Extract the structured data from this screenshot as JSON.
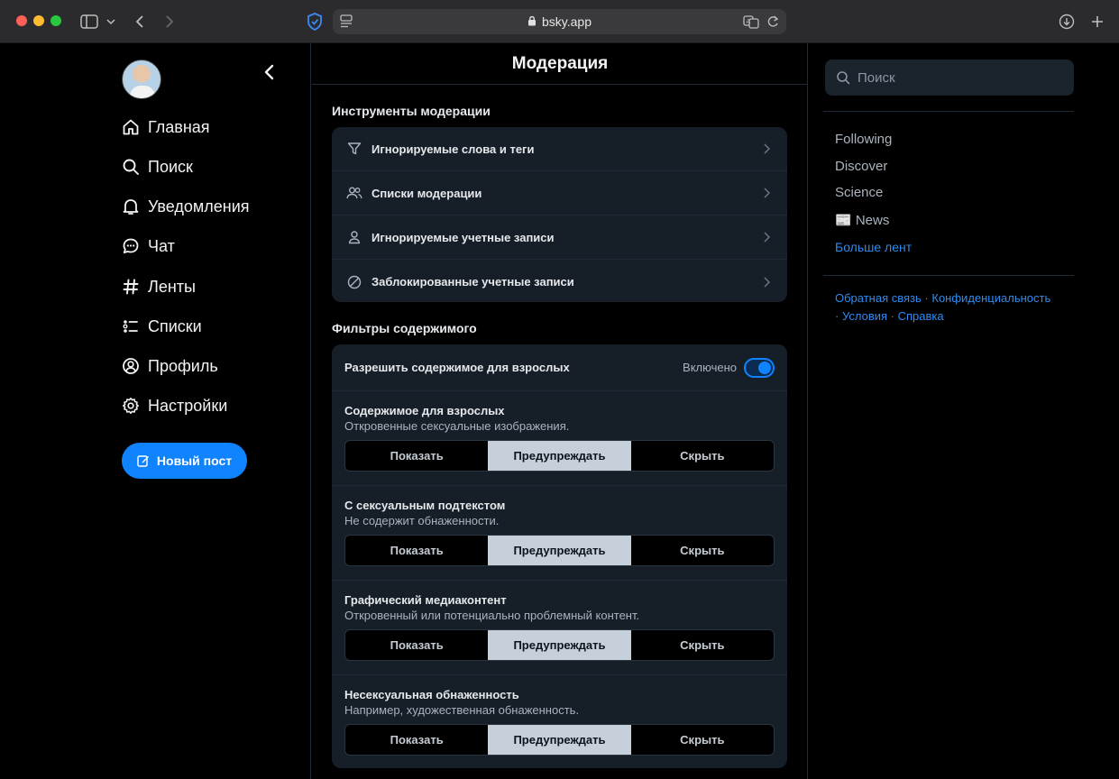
{
  "browser": {
    "url": "bsky.app"
  },
  "nav": {
    "items": [
      {
        "label": "Главная"
      },
      {
        "label": "Поиск"
      },
      {
        "label": "Уведомления"
      },
      {
        "label": "Чат"
      },
      {
        "label": "Ленты"
      },
      {
        "label": "Списки"
      },
      {
        "label": "Профиль"
      },
      {
        "label": "Настройки"
      }
    ],
    "new_post": "Новый пост"
  },
  "main": {
    "title": "Модерация",
    "tools_title": "Инструменты модерации",
    "tools": [
      {
        "label": "Игнорируемые слова и теги",
        "icon": "filter-icon"
      },
      {
        "label": "Списки модерации",
        "icon": "users-icon"
      },
      {
        "label": "Игнорируемые учетные записи",
        "icon": "person-icon"
      },
      {
        "label": "Заблокированные учетные записи",
        "icon": "block-icon"
      }
    ],
    "filters_title": "Фильтры содержимого",
    "adult": {
      "label": "Разрешить содержимое для взрослых",
      "state": "Включено",
      "enabled": true
    },
    "options": [
      "Показать",
      "Предупреждать",
      "Скрыть"
    ],
    "filters": [
      {
        "title": "Содержимое для взрослых",
        "desc": "Откровенные сексуальные изображения.",
        "selected": "Предупреждать"
      },
      {
        "title": "С сексуальным подтекстом",
        "desc": "Не содержит обнаженности.",
        "selected": "Предупреждать"
      },
      {
        "title": "Графический медиаконтент",
        "desc": "Откровенный или потенциально проблемный контент.",
        "selected": "Предупреждать"
      },
      {
        "title": "Несексуальная обнаженность",
        "desc": "Например, художественная обнаженность.",
        "selected": "Предупреждать"
      }
    ]
  },
  "right": {
    "search_placeholder": "Поиск",
    "feeds": [
      "Following",
      "Discover",
      "Science",
      "📰 News"
    ],
    "more_feeds": "Больше лент",
    "footer": {
      "feedback": "Обратная связь",
      "privacy": "Конфиденциальность",
      "terms": "Условия",
      "help": "Справка",
      "sep": "·"
    }
  },
  "colors": {
    "accent": "#1083fe",
    "link": "#2e8bf0",
    "card": "#161e27"
  }
}
